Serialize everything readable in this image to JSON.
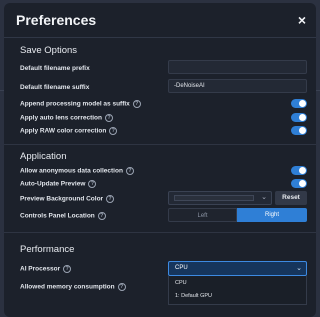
{
  "dialog": {
    "title": "Preferences",
    "close_glyph": "×"
  },
  "sections": {
    "save_options": {
      "title": "Save Options",
      "filename_prefix": {
        "label": "Default filename prefix",
        "value": ""
      },
      "filename_suffix": {
        "label": "Default filename suffix",
        "value": "-DeNoiseAI"
      },
      "append_model": {
        "label": "Append processing model as suffix",
        "on": true
      },
      "auto_lens": {
        "label": "Apply auto lens correction",
        "on": true
      },
      "raw_color": {
        "label": "Apply RAW color correction",
        "on": true
      }
    },
    "application": {
      "title": "Application",
      "anon_data": {
        "label": "Allow anonymous data collection",
        "on": true
      },
      "auto_update": {
        "label": "Auto-Update Preview",
        "on": true
      },
      "bg_color": {
        "label": "Preview Background Color",
        "reset_label": "Reset"
      },
      "panel_location": {
        "label": "Controls Panel Location",
        "options": [
          "Left",
          "Right"
        ],
        "selected": "Right"
      }
    },
    "performance": {
      "title": "Performance",
      "ai_processor": {
        "label": "AI Processor",
        "value": "CPU",
        "options": [
          "CPU",
          "1: Default GPU"
        ]
      },
      "memory": {
        "label": "Allowed memory consumption"
      }
    }
  },
  "colors": {
    "accent": "#2f7fd6",
    "dialog_bg": "#1c212b"
  },
  "icons": {
    "help": "help-circle-icon",
    "chevron": "chevron-down-icon",
    "close": "close-icon"
  }
}
